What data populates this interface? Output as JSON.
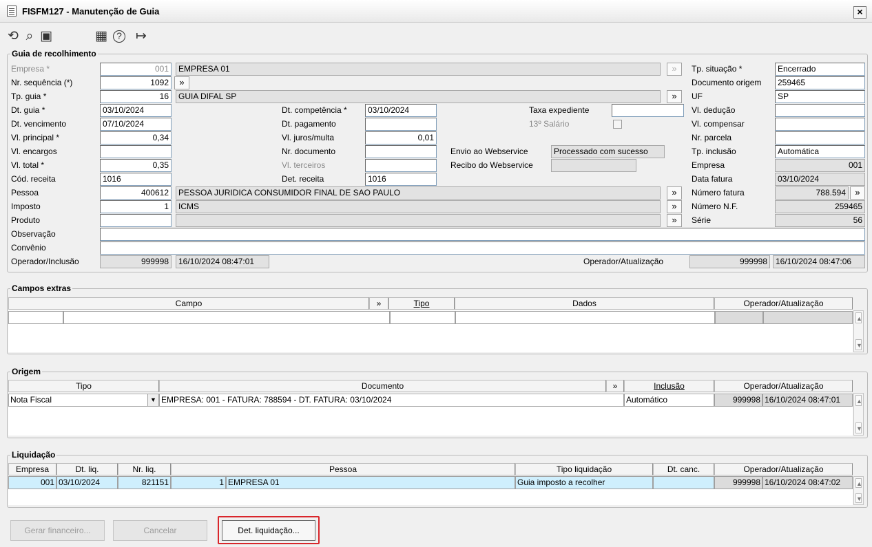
{
  "window": {
    "title": "FISFM127 - Manutenção de Guia",
    "close_glyph": "×"
  },
  "toolbar": {
    "icons": [
      "undo-icon",
      "search-icon",
      "save-icon",
      "calendar-icon",
      "help-icon",
      "exit-icon"
    ],
    "glyphs": {
      "undo": "⟲",
      "search": "⌕",
      "save": "▣",
      "calendar": "▦",
      "help": "?",
      "exit": "↦"
    }
  },
  "guia": {
    "legend": "Guia de recolhimento",
    "empresa": {
      "label": "Empresa *",
      "code": "001",
      "name": "EMPRESA 01"
    },
    "nr_sequencia": {
      "label": "Nr. sequência (*)",
      "value": "1092"
    },
    "tp_guia": {
      "label": "Tp. guia *",
      "code": "16",
      "name": "GUIA DIFAL SP"
    },
    "dt_guia": {
      "label": "Dt. guia *",
      "value": "03/10/2024"
    },
    "dt_vencimento": {
      "label": "Dt. vencimento",
      "value": "07/10/2024"
    },
    "vl_principal": {
      "label": "Vl. principal *",
      "value": "0,34"
    },
    "vl_encargos": {
      "label": "Vl. encargos",
      "value": ""
    },
    "vl_total": {
      "label": "Vl. total *",
      "value": "0,35"
    },
    "cod_receita": {
      "label": "Cód. receita",
      "value": "1016"
    },
    "pessoa": {
      "label": "Pessoa",
      "code": "400612",
      "name": "PESSOA JURIDICA CONSUMIDOR FINAL DE SAO PAULO"
    },
    "imposto": {
      "label": "Imposto",
      "code": "1",
      "name": "ICMS"
    },
    "produto": {
      "label": "Produto",
      "code": "",
      "name": ""
    },
    "observacao": {
      "label": "Observação",
      "value": ""
    },
    "convenio": {
      "label": "Convênio",
      "value": ""
    },
    "operador_inclusao": {
      "label": "Operador/Inclusão",
      "code": "999998",
      "datetime": "16/10/2024 08:47:01"
    },
    "dt_competencia": {
      "label": "Dt. competência *",
      "value": "03/10/2024"
    },
    "dt_pagamento": {
      "label": "Dt. pagamento",
      "value": ""
    },
    "vl_juros": {
      "label": "Vl. juros/multa",
      "value": "0,01"
    },
    "nr_documento": {
      "label": "Nr. documento",
      "value": ""
    },
    "vl_terceiros": {
      "label": "Vl. terceiros",
      "value": ""
    },
    "det_receita": {
      "label": "Det. receita",
      "value": "1016"
    },
    "taxa_expediente": {
      "label": "Taxa expediente",
      "value": ""
    },
    "decimo_terceiro": {
      "label": "13º Salário"
    },
    "envio_webservice": {
      "label": "Envio ao Webservice",
      "value": "Processado com sucesso"
    },
    "recibo_webservice": {
      "label": "Recibo do Webservice",
      "value": ""
    },
    "tp_situacao": {
      "label": "Tp. situação *",
      "value": "Encerrado"
    },
    "documento_origem": {
      "label": "Documento origem",
      "value": "259465"
    },
    "uf": {
      "label": "UF",
      "value": "SP"
    },
    "vl_deducao": {
      "label": "Vl. dedução",
      "value": ""
    },
    "vl_compensar": {
      "label": "Vl. compensar",
      "value": ""
    },
    "nr_parcela": {
      "label": "Nr. parcela",
      "value": ""
    },
    "tp_inclusao": {
      "label": "Tp. inclusão",
      "value": "Automática"
    },
    "empresa_r": {
      "label": "Empresa",
      "value": "001"
    },
    "data_fatura": {
      "label": "Data fatura",
      "value": "03/10/2024"
    },
    "numero_fatura": {
      "label": "Número fatura",
      "value": "788.594"
    },
    "numero_nf": {
      "label": "Número N.F.",
      "value": "259465"
    },
    "serie": {
      "label": "Série",
      "value": "56"
    },
    "operador_atualizacao": {
      "label": "Operador/Atualização",
      "code": "999998",
      "datetime": "16/10/2024 08:47:06"
    },
    "lookup_glyph": "»"
  },
  "campos_extras": {
    "legend": "Campos extras",
    "columns": {
      "campo": "Campo",
      "tipo": "Tipo",
      "dados": "Dados",
      "operador": "Operador/Atualização"
    }
  },
  "origem": {
    "legend": "Origem",
    "columns": {
      "tipo": "Tipo",
      "documento": "Documento",
      "inclusao": "Inclusão",
      "operador": "Operador/Atualização"
    },
    "row": {
      "tipo": "Nota Fiscal",
      "documento": "EMPRESA: 001 - FATURA: 788594 - DT. FATURA: 03/10/2024",
      "inclusao": "Automático",
      "operador_code": "999998",
      "operador_datetime": "16/10/2024 08:47:01"
    }
  },
  "liquidacao": {
    "legend": "Liquidação",
    "columns": {
      "empresa": "Empresa",
      "dt_liq": "Dt. liq.",
      "nr_liq": "Nr. liq.",
      "pessoa": "Pessoa",
      "tipo_liq": "Tipo liquidação",
      "dt_canc": "Dt. canc.",
      "operador": "Operador/Atualização"
    },
    "row": {
      "empresa": "001",
      "dt_liq": "03/10/2024",
      "nr_liq": "821151",
      "pessoa_code": "1",
      "pessoa_name": "EMPRESA 01",
      "tipo_liq": "Guia imposto a recolher",
      "dt_canc": "",
      "operador_code": "999998",
      "operador_datetime": "16/10/2024 08:47:02"
    }
  },
  "buttons": {
    "gerar_financeiro": "Gerar financeiro...",
    "cancelar": "Cancelar",
    "det_liquidacao": "Det. liquidação..."
  },
  "colors": {
    "highlight": "#d9262b",
    "selected_row": "#cfeffd",
    "readonly": "#e2e2e2"
  }
}
